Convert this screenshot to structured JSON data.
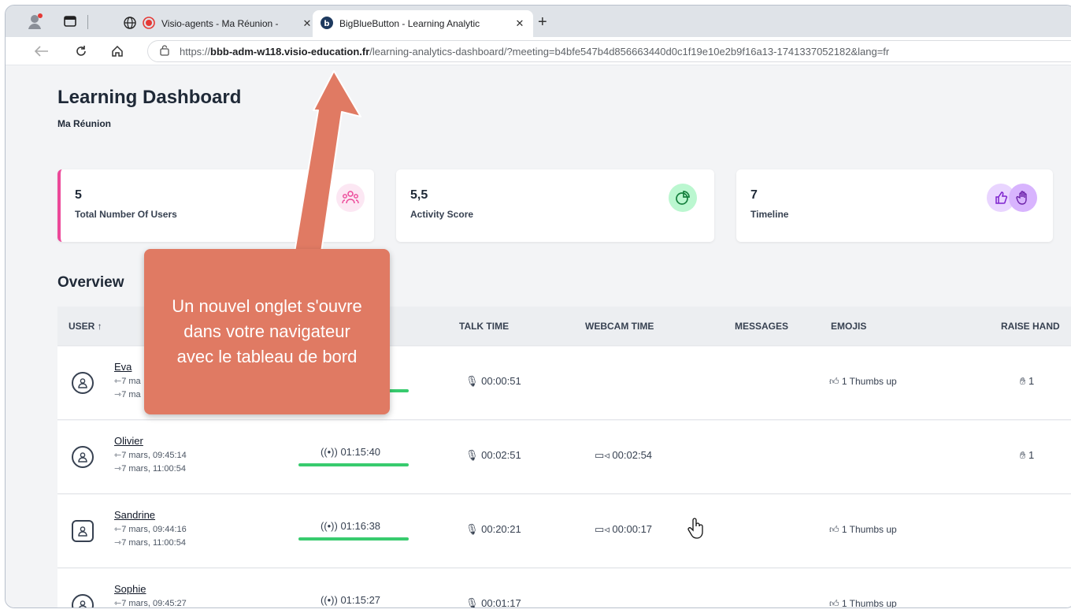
{
  "browser": {
    "tabs": [
      {
        "title": "Visio-agents - Ma Réunion -",
        "active": false
      },
      {
        "title": "BigBlueButton - Learning Analytic",
        "active": true
      }
    ],
    "url_prefix": "https://",
    "url_domain": "bbb-adm-w118.visio-education.fr",
    "url_path": "/learning-analytics-dashboard/?meeting=b4bfe547b4d856663440d0c1f19e10e2b9f16a13-1741337052182&lang=fr"
  },
  "dashboard": {
    "title": "Learning Dashboard",
    "meeting": "Ma Réunion",
    "cards": [
      {
        "value": "5",
        "label": "Total Number Of Users",
        "icon": "users-icon",
        "accent": "#ec4899"
      },
      {
        "value": "5,5",
        "label": "Activity Score",
        "icon": "pie-chart-icon",
        "accent": "#22c55e"
      },
      {
        "value": "7",
        "label": "Timeline",
        "icon": "thumbs-hand-icon",
        "accent": "#a855f7"
      }
    ],
    "overview_title": "Overview",
    "columns": {
      "user": "USER ↑",
      "talk": "TALK TIME",
      "webcam": "WEBCAM TIME",
      "messages": "MESSAGES",
      "emojis": "EMOJIS",
      "raise": "RAISE HAND"
    },
    "rows": [
      {
        "name": "Eva",
        "join": "7 ma",
        "leave": "7 ma",
        "online": "",
        "talk": "00:00:51",
        "webcam": "",
        "emoji": "1 Thumbs up",
        "hand": "1"
      },
      {
        "name": "Olivier",
        "join": "7 mars, 09:45:14",
        "leave": "7 mars, 11:00:54",
        "online": "01:15:40",
        "talk": "00:02:51",
        "webcam": "00:02:54",
        "emoji": "",
        "hand": "1"
      },
      {
        "name": "Sandrine",
        "join": "7 mars, 09:44:16",
        "leave": "7 mars, 11:00:54",
        "online": "01:16:38",
        "talk": "00:20:21",
        "webcam": "00:00:17",
        "emoji": "1 Thumbs up",
        "hand": ""
      },
      {
        "name": "Sophie",
        "join": "7 mars, 09:45:27",
        "leave": "",
        "online": "01:15:27",
        "talk": "00:01:17",
        "webcam": "",
        "emoji": "1 Thumbs up",
        "hand": ""
      }
    ]
  },
  "callout": {
    "text": "Un nouvel onglet s'ouvre dans votre navigateur avec le tableau de bord",
    "color": "#e07a63"
  }
}
